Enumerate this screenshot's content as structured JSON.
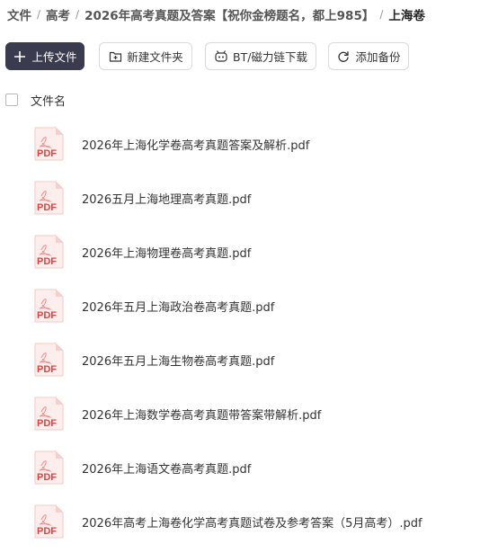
{
  "breadcrumb": {
    "items": [
      "文件",
      "高考",
      "2026年高考真题及答案【祝你金榜题名，都上985】",
      "上海卷"
    ],
    "separator": "/"
  },
  "toolbar": {
    "upload_label": "上传文件",
    "new_folder_label": "新建文件夹",
    "bt_label": "BT/磁力链下载",
    "backup_label": "添加备份"
  },
  "table": {
    "column_name": "文件名"
  },
  "files": [
    {
      "name": "2026年上海化学卷高考真题答案及解析.pdf",
      "type": "PDF"
    },
    {
      "name": "2026五月上海地理高考真题.pdf",
      "type": "PDF"
    },
    {
      "name": "2026年上海物理卷高考真题.pdf",
      "type": "PDF"
    },
    {
      "name": "2026年五月上海政治卷高考真题.pdf",
      "type": "PDF"
    },
    {
      "name": "2026年五月上海生物卷高考真题.pdf",
      "type": "PDF"
    },
    {
      "name": "2026年上海数学卷高考真题带答案带解析.pdf",
      "type": "PDF"
    },
    {
      "name": "2026年上海语文卷高考真题.pdf",
      "type": "PDF"
    },
    {
      "name": "2026年高考上海卷化学高考真题试卷及参考答案（5月高考）.pdf",
      "type": "PDF"
    }
  ],
  "icons": {
    "upload": "plus-icon",
    "new_folder": "folder-plus-icon",
    "bt": "bt-robot-icon",
    "backup": "refresh-icon",
    "file": "pdf-file-icon"
  },
  "colors": {
    "primary_button": "#3b3b4f",
    "pdf_red": "#e5403a"
  }
}
